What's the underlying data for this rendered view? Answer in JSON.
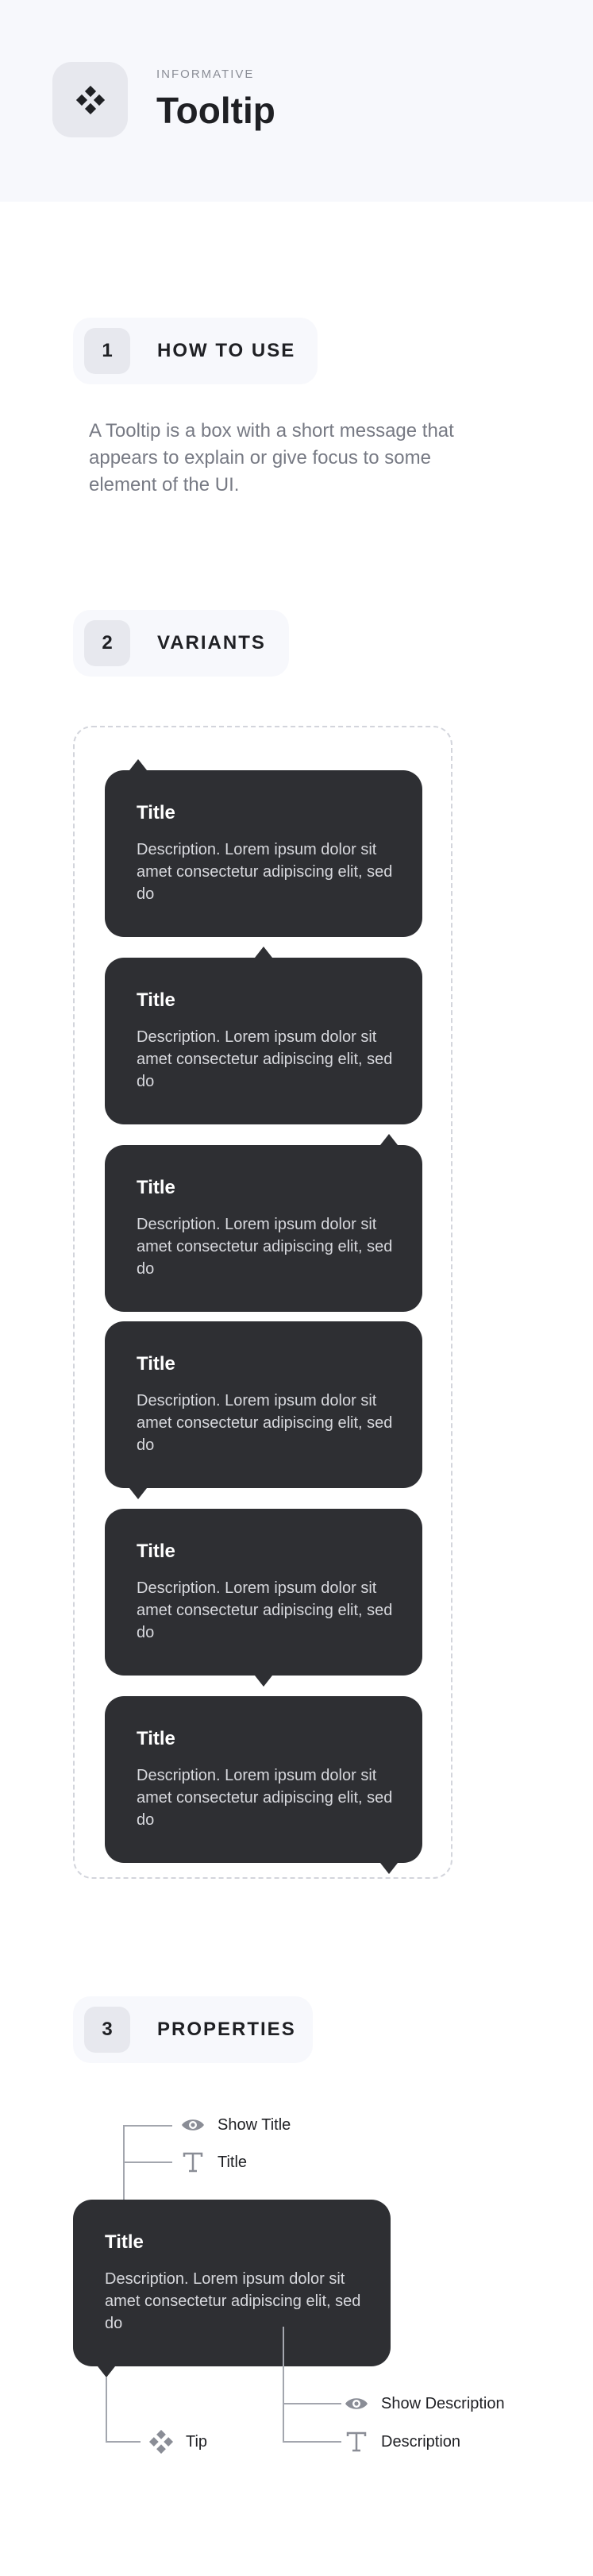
{
  "header": {
    "category": "INFORMATIVE",
    "title": "Tooltip",
    "icon": "component-diamond-icon"
  },
  "sections": [
    {
      "number": "1",
      "label": "HOW TO USE"
    },
    {
      "number": "2",
      "label": "VARIANTS"
    },
    {
      "number": "3",
      "label": "PROPERTIES"
    }
  ],
  "how_to_use": {
    "text": "A Tooltip is a box with a short message that appears to explain or give focus to some element of the UI."
  },
  "tooltip": {
    "title": "Title",
    "description": "Description. Lorem ipsum dolor sit amet consectetur adipiscing elit, sed do"
  },
  "variants": [
    {
      "tip": "top-left"
    },
    {
      "tip": "top-center"
    },
    {
      "tip": "top-right"
    },
    {
      "tip": "bottom-left"
    },
    {
      "tip": "bottom-center"
    },
    {
      "tip": "bottom-right"
    }
  ],
  "properties": {
    "show_title": "Show Title",
    "title": "Title",
    "tip": "Tip",
    "show_description": "Show Description",
    "description": "Description"
  },
  "colors": {
    "tooltip_bg": "#2e2f33",
    "header_bg": "#f7f8fc",
    "pill_bg": "#f7f8fc",
    "chip_bg": "#e7e8ee",
    "connector": "#a3a6ae"
  }
}
